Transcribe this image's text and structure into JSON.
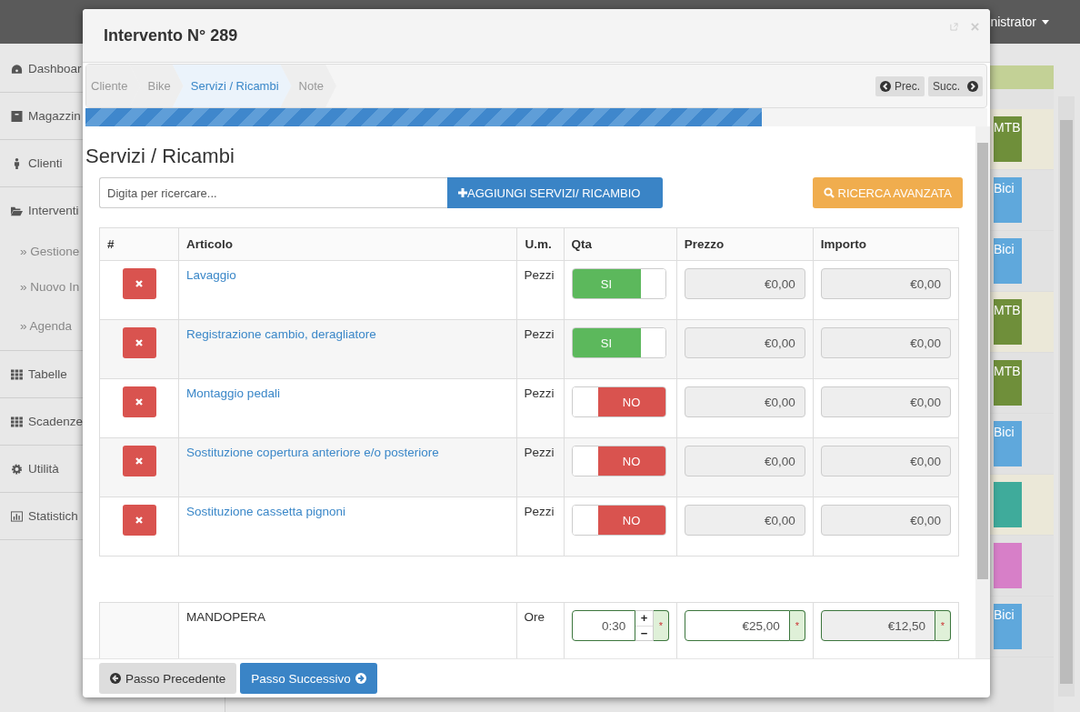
{
  "topbar": {
    "user": "nistrator"
  },
  "sidebar": {
    "items": [
      {
        "label": "Dashboar",
        "kind": "section"
      },
      {
        "label": "Magazzin",
        "kind": "section"
      },
      {
        "label": "Clienti",
        "kind": "section"
      },
      {
        "label": "Interventi",
        "kind": "section"
      },
      {
        "label": "» Gestione",
        "kind": "subitem"
      },
      {
        "label": "» Nuovo In",
        "kind": "subitem"
      },
      {
        "label": "» Agenda",
        "kind": "subitem"
      },
      {
        "label": "Tabelle",
        "kind": "section"
      },
      {
        "label": "Scadenze",
        "kind": "section"
      },
      {
        "label": "Utilità",
        "kind": "section"
      },
      {
        "label": "Statistich",
        "kind": "section"
      }
    ]
  },
  "background_tags": [
    {
      "label": "MTB",
      "color": "#6f8f3a"
    },
    {
      "label": "Bici",
      "color": "#5fa8dc"
    },
    {
      "label": "Bici",
      "color": "#5fa8dc"
    },
    {
      "label": "MTB",
      "color": "#6f8f3a"
    },
    {
      "label": "MTB",
      "color": "#6f8f3a"
    },
    {
      "label": "Bici",
      "color": "#5fa8dc"
    },
    {
      "color": "#3fab9b"
    },
    {
      "color": "#d77fc8"
    },
    {
      "label": "Bici",
      "color": "#5fa8dc"
    }
  ],
  "modal": {
    "title": "Intervento N° 289",
    "wizard": {
      "steps": [
        {
          "label": "Cliente",
          "selected": false
        },
        {
          "label": "Bike",
          "selected": false
        },
        {
          "label": "Servizi / Ricambi",
          "selected": true
        },
        {
          "label": "Note",
          "selected": false
        }
      ],
      "prev": "Prec.",
      "next": "Succ.",
      "level": 0.75
    },
    "heading": "Servizi / Ricambi",
    "search": {
      "placeholder": "Digita per ricercare..."
    },
    "add_button": "AGGIUNGI SERVIZI/ RICAMBIO",
    "advanced_button": "RICERCA AVANZATA",
    "table": {
      "columns": [
        "#",
        "Articolo",
        "U.m.",
        "Qta",
        "Prezzo",
        "Importo"
      ],
      "rows": [
        {
          "name": "Lavaggio",
          "unit": "Pezzi",
          "on": true,
          "toggle_label": "SI",
          "price": "€0,00",
          "amount": "€0,00"
        },
        {
          "name": "Registrazione cambio, deragliatore",
          "unit": "Pezzi",
          "on": true,
          "toggle_label": "SI",
          "price": "€0,00",
          "amount": "€0,00"
        },
        {
          "name": "Montaggio pedali",
          "unit": "Pezzi",
          "on": false,
          "toggle_label": "NO",
          "price": "€0,00",
          "amount": "€0,00"
        },
        {
          "name": "Sostituzione copertura anteriore e/o posteriore",
          "unit": "Pezzi",
          "on": false,
          "toggle_label": "NO",
          "price": "€0,00",
          "amount": "€0,00"
        },
        {
          "name": "Sostituzione cassetta pignoni",
          "unit": "Pezzi",
          "on": false,
          "toggle_label": "NO",
          "price": "€0,00",
          "amount": "€0,00"
        }
      ]
    },
    "labor": {
      "name": "MANDOPERA",
      "unit": "Ore",
      "qty": "0:30",
      "plus": "+",
      "minus": "−",
      "price": "€25,00",
      "amount": "€12,50",
      "required_marks": [
        "*",
        "*",
        "*"
      ]
    },
    "footer": {
      "back": "Passo Precedente",
      "next": "Passo Successivo"
    }
  }
}
